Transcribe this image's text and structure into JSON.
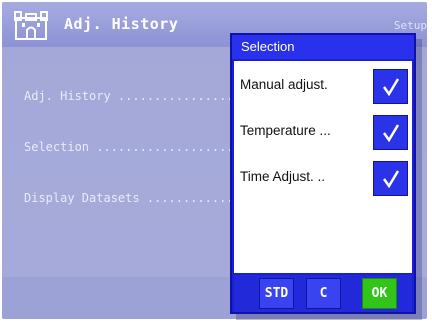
{
  "window": {
    "title": "Adj. History",
    "title_right_partial": "Setup"
  },
  "list": {
    "items": [
      {
        "label": "Adj. History ........................"
      },
      {
        "label": "Selection ..........................."
      },
      {
        "label": "Display Datasets ..................."
      }
    ]
  },
  "dialog": {
    "title": "Selection",
    "options": [
      {
        "label": "Manual adjust.",
        "checked": true
      },
      {
        "label": "Temperature ...",
        "checked": true
      },
      {
        "label": "Time Adjust. ..",
        "checked": true
      }
    ],
    "buttons": {
      "std_label": "STD",
      "c_label": "C",
      "ok_label": "OK"
    }
  },
  "colors": {
    "accent_blue": "#2a33e8",
    "ok_green": "#33c41a",
    "background_lavender": "#a6abda"
  },
  "icons": {
    "app_icon": "castle-icon",
    "check_icon": "checkmark-icon"
  }
}
